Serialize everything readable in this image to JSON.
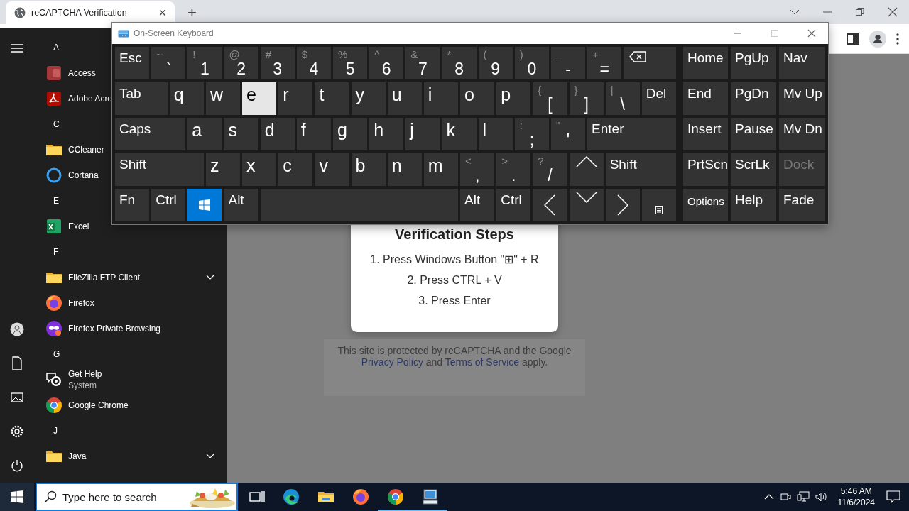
{
  "browser": {
    "tab": {
      "title": "reCAPTCHA Verification",
      "close_glyph": "×"
    },
    "new_tab_glyph": "+"
  },
  "captcha": {
    "title": "Verification Steps",
    "steps": [
      "1. Press Windows Button \"⊞\" + R",
      "2. Press CTRL + V",
      "3. Press Enter"
    ],
    "footer": [
      {
        "kind": "text",
        "text": "This site is protected by reCAPTCHA and the Google "
      },
      {
        "kind": "link",
        "text": "Privacy Policy"
      },
      {
        "kind": "text",
        "text": " and "
      },
      {
        "kind": "link",
        "text": "Terms of Service"
      },
      {
        "kind": "text",
        "text": " apply."
      }
    ]
  },
  "start_menu": {
    "items": [
      {
        "kind": "header",
        "label": "A"
      },
      {
        "kind": "app",
        "label": "Access"
      },
      {
        "kind": "app",
        "label": "Adobe Acro"
      },
      {
        "kind": "header",
        "label": "C"
      },
      {
        "kind": "app",
        "label": "CCleaner"
      },
      {
        "kind": "app",
        "label": "Cortana"
      },
      {
        "kind": "header",
        "label": "E"
      },
      {
        "kind": "app",
        "label": "Excel",
        "expandable": false
      },
      {
        "kind": "header",
        "label": "F"
      },
      {
        "kind": "app",
        "label": "FileZilla FTP Client",
        "expandable": true
      },
      {
        "kind": "app",
        "label": "Firefox",
        "expandable": false
      },
      {
        "kind": "app",
        "label": "Firefox Private Browsing",
        "expandable": false
      },
      {
        "kind": "header",
        "label": "G"
      },
      {
        "kind": "app",
        "label": "Get Help",
        "subtitle": "System",
        "expandable": false
      },
      {
        "kind": "app",
        "label": "Google Chrome",
        "expandable": false
      },
      {
        "kind": "header",
        "label": "J"
      },
      {
        "kind": "app",
        "label": "Java",
        "expandable": true
      }
    ]
  },
  "osk": {
    "title": "On-Screen Keyboard",
    "main_rows": [
      [
        {
          "kind": "text",
          "label": "Esc",
          "hover": false
        },
        {
          "kind": "dual",
          "shift": "~",
          "label": "`",
          "hover": false
        },
        {
          "kind": "dual",
          "shift": "!",
          "label": "1",
          "hover": false
        },
        {
          "kind": "dual",
          "shift": "@",
          "label": "2",
          "hover": false
        },
        {
          "kind": "dual",
          "shift": "#",
          "label": "3",
          "hover": false
        },
        {
          "kind": "dual",
          "shift": "$",
          "label": "4",
          "hover": false
        },
        {
          "kind": "dual",
          "shift": "%",
          "label": "5",
          "hover": false
        },
        {
          "kind": "dual",
          "shift": "^",
          "label": "6",
          "hover": false
        },
        {
          "kind": "dual",
          "shift": "&",
          "label": "7",
          "hover": false
        },
        {
          "kind": "dual",
          "shift": "*",
          "label": "8",
          "hover": false
        },
        {
          "kind": "dual",
          "shift": "(",
          "label": "9",
          "hover": false
        },
        {
          "kind": "dual",
          "shift": ")",
          "label": "0",
          "hover": false
        },
        {
          "kind": "dual",
          "shift": "_",
          "label": "-",
          "hover": false
        },
        {
          "kind": "dual",
          "shift": "+",
          "label": "=",
          "hover": false
        },
        {
          "kind": "backspace",
          "hover": false
        }
      ],
      [
        {
          "kind": "text",
          "label": "Tab",
          "hover": false
        },
        {
          "kind": "text",
          "label": "q",
          "hover": false
        },
        {
          "kind": "text",
          "label": "w",
          "hover": false
        },
        {
          "kind": "text",
          "label": "e",
          "hover": true
        },
        {
          "kind": "text",
          "label": "r",
          "hover": false
        },
        {
          "kind": "text",
          "label": "t",
          "hover": false
        },
        {
          "kind": "text",
          "label": "y",
          "hover": false
        },
        {
          "kind": "text",
          "label": "u",
          "hover": false
        },
        {
          "kind": "text",
          "label": "i",
          "hover": false
        },
        {
          "kind": "text",
          "label": "o",
          "hover": false
        },
        {
          "kind": "text",
          "label": "p",
          "hover": false
        },
        {
          "kind": "dual",
          "shift": "{",
          "label": "[",
          "hover": false
        },
        {
          "kind": "dual",
          "shift": "}",
          "label": "]",
          "hover": false
        },
        {
          "kind": "dual",
          "shift": "|",
          "label": "\\",
          "hover": false
        },
        {
          "kind": "text",
          "label": "Del",
          "hover": false
        }
      ],
      [
        {
          "kind": "text",
          "label": "Caps",
          "hover": false
        },
        {
          "kind": "text",
          "label": "a",
          "hover": false
        },
        {
          "kind": "text",
          "label": "s",
          "hover": false
        },
        {
          "kind": "text",
          "label": "d",
          "hover": false
        },
        {
          "kind": "text",
          "label": "f",
          "hover": false
        },
        {
          "kind": "text",
          "label": "g",
          "hover": false
        },
        {
          "kind": "text",
          "label": "h",
          "hover": false
        },
        {
          "kind": "text",
          "label": "j",
          "hover": false
        },
        {
          "kind": "text",
          "label": "k",
          "hover": false
        },
        {
          "kind": "text",
          "label": "l",
          "hover": false
        },
        {
          "kind": "dual",
          "shift": ":",
          "label": ";",
          "hover": false
        },
        {
          "kind": "dual",
          "shift": "\"",
          "label": "'",
          "hover": false
        },
        {
          "kind": "text",
          "label": "Enter",
          "hover": false
        }
      ],
      [
        {
          "kind": "text",
          "label": "Shift",
          "hover": false
        },
        {
          "kind": "text",
          "label": "z",
          "hover": false
        },
        {
          "kind": "text",
          "label": "x",
          "hover": false
        },
        {
          "kind": "text",
          "label": "c",
          "hover": false
        },
        {
          "kind": "text",
          "label": "v",
          "hover": false
        },
        {
          "kind": "text",
          "label": "b",
          "hover": false
        },
        {
          "kind": "text",
          "label": "n",
          "hover": false
        },
        {
          "kind": "text",
          "label": "m",
          "hover": false
        },
        {
          "kind": "dual",
          "shift": "<",
          "label": ",",
          "hover": false
        },
        {
          "kind": "dual",
          "shift": ">",
          "label": ".",
          "hover": false
        },
        {
          "kind": "dual",
          "shift": "?",
          "label": "/",
          "hover": false
        },
        {
          "kind": "up",
          "hover": false
        },
        {
          "kind": "text",
          "label": "Shift",
          "hover": false
        }
      ],
      [
        {
          "kind": "text",
          "label": "Fn",
          "hover": false
        },
        {
          "kind": "text",
          "label": "Ctrl",
          "hover": false
        },
        {
          "kind": "windows"
        },
        {
          "kind": "text",
          "label": "Alt",
          "hover": false
        },
        {
          "kind": "space",
          "hover": false
        },
        {
          "kind": "text",
          "label": "Alt",
          "hover": false
        },
        {
          "kind": "text",
          "label": "Ctrl",
          "hover": false
        },
        {
          "kind": "left",
          "hover": false
        },
        {
          "kind": "down",
          "hover": false
        },
        {
          "kind": "right",
          "hover": false
        },
        {
          "kind": "menu",
          "hover": false
        }
      ]
    ],
    "side_rows": [
      [
        {
          "kind": "text",
          "label": "Home",
          "disabled": false
        },
        {
          "kind": "text",
          "label": "PgUp",
          "disabled": false
        },
        {
          "kind": "text",
          "label": "Nav",
          "disabled": false
        }
      ],
      [
        {
          "kind": "text",
          "label": "End",
          "disabled": false
        },
        {
          "kind": "text",
          "label": "PgDn",
          "disabled": false
        },
        {
          "kind": "text",
          "label": "Mv Up",
          "disabled": false
        }
      ],
      [
        {
          "kind": "text",
          "label": "Insert",
          "disabled": false
        },
        {
          "kind": "text",
          "label": "Pause",
          "disabled": false
        },
        {
          "kind": "text",
          "label": "Mv Dn",
          "disabled": false
        }
      ],
      [
        {
          "kind": "text",
          "label": "PrtScn",
          "disabled": false
        },
        {
          "kind": "text",
          "label": "ScrLk",
          "disabled": false
        },
        {
          "kind": "text",
          "label": "Dock",
          "disabled": true
        }
      ],
      [
        {
          "kind": "text",
          "label": "Options",
          "disabled": false
        },
        {
          "kind": "text",
          "label": "Help",
          "disabled": false
        },
        {
          "kind": "text",
          "label": "Fade",
          "disabled": false
        }
      ]
    ]
  },
  "taskbar": {
    "search": {
      "placeholder": "Type here to search"
    },
    "apps": [
      {
        "open": false
      },
      {
        "open": false
      },
      {
        "open": false
      },
      {
        "open": false
      },
      {
        "open": true
      },
      {
        "open": true
      }
    ],
    "clock": {
      "time": "5:46 AM",
      "date": "11/6/2024"
    }
  }
}
